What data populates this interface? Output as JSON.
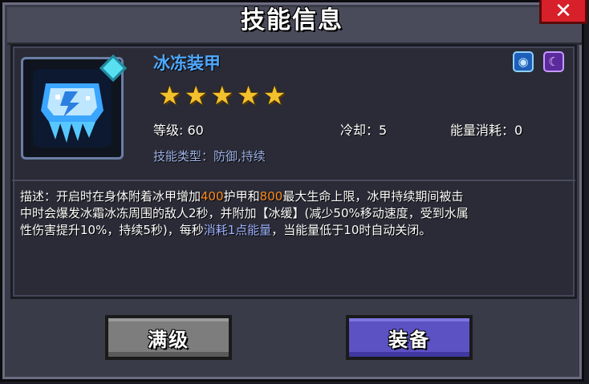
{
  "header": {
    "title": "技能信息",
    "close_label": "✕"
  },
  "skill": {
    "name": "冰冻装甲",
    "rating_stars": 5,
    "stars": [
      "★",
      "★",
      "★",
      "★",
      "★"
    ],
    "level_label": "等级: 60",
    "cooldown_label": "冷却：5",
    "energy_label": "能量消耗：0",
    "type_label": "技能类型：防御,持续",
    "badges": {
      "shield_icon": "shield-icon",
      "magic_icon": "magic-icon"
    }
  },
  "description": {
    "prefix": "描述：开启时在身体附着冰甲增加",
    "armor_value": "400",
    "mid1": "护甲和",
    "hp_value": "800",
    "mid2": "最大生命上限，冰甲持续期间被击\n中时会爆发冰霜冰冻周围的敌人2秒，并附加【冰缓】(减少50%移动速度，受到水属\n性伤害提升10%，持续5秒)，每秒",
    "energy_highlight": "消耗1点能量",
    "suffix": "，当能量低于10时自动关闭。"
  },
  "buttons": {
    "max_label": "满级",
    "equip_label": "装备"
  },
  "colors": {
    "title_text": "#ffffff",
    "skill_name": "#4fa8ff",
    "star": "#f2c12e",
    "highlight_orange": "#ff8a1e",
    "highlight_blue": "#9fb3ff",
    "equip_button": "#5c52c4",
    "max_button": "#7d7d7d",
    "close_button": "#d8202a"
  }
}
